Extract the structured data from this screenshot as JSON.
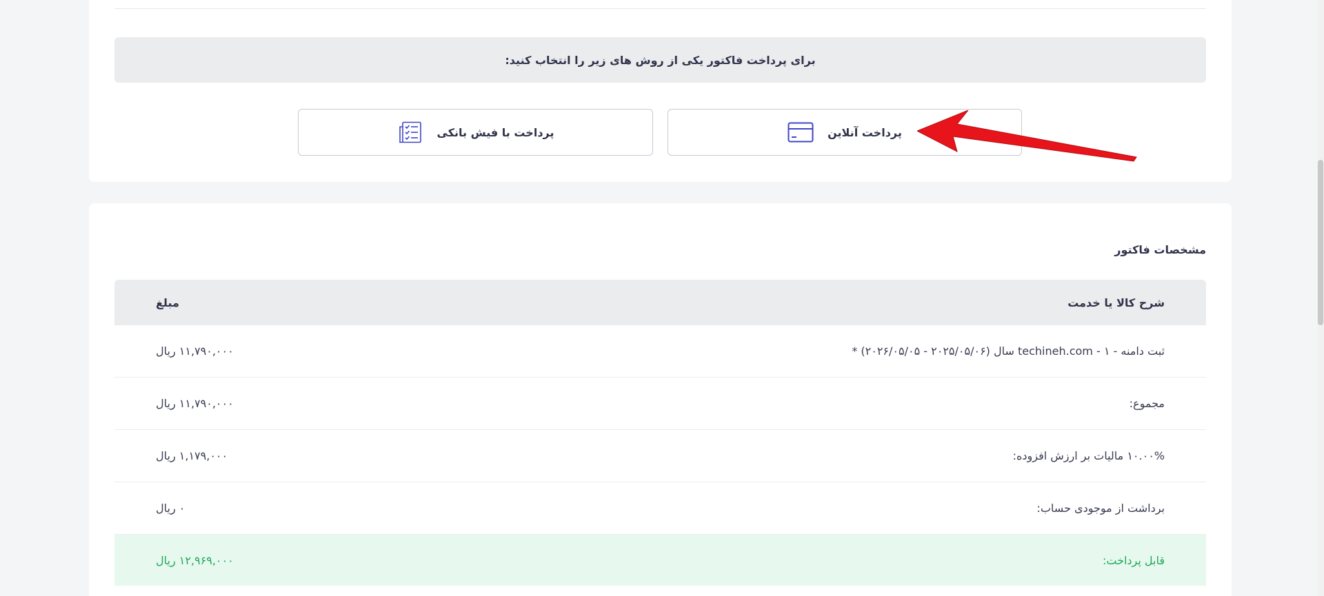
{
  "payment": {
    "instruction": "برای پرداخت فاکتور یکی از روش های زیر را انتخاب کنید:",
    "online_label": "پرداخت آنلاین",
    "online_icon": "credit-card-icon",
    "slip_label": "پرداخت با فیش بانکی",
    "slip_icon": "checklist-icon",
    "icon_color": "#3f46c5"
  },
  "invoice": {
    "title": "مشخصات فاکتور",
    "header": {
      "description": "شرح کالا یا خدمت",
      "amount": "مبلغ"
    },
    "rows": [
      {
        "description": "ثبت دامنه - ۱ - techineh.com سال (۲۰۲۵/۰۵/۰۶ - ۲۰۲۶/۰۵/۰۵) *",
        "amount": "۱۱,۷۹۰,۰۰۰ ریال"
      },
      {
        "description": "مجموع:",
        "amount": "۱۱,۷۹۰,۰۰۰ ریال"
      },
      {
        "description": "۱۰.۰۰% مالیات بر ارزش افزوده:",
        "amount": "۱,۱۷۹,۰۰۰ ریال"
      },
      {
        "description": "برداشت از موجودی حساب:",
        "amount": "۰ ریال"
      }
    ],
    "total": {
      "description": "قابل پرداخت:",
      "amount": "۱۲,۹۶۹,۰۰۰ ریال"
    },
    "total_color": "#1fa75a"
  },
  "annotation": {
    "arrow_color": "#e8141b"
  }
}
